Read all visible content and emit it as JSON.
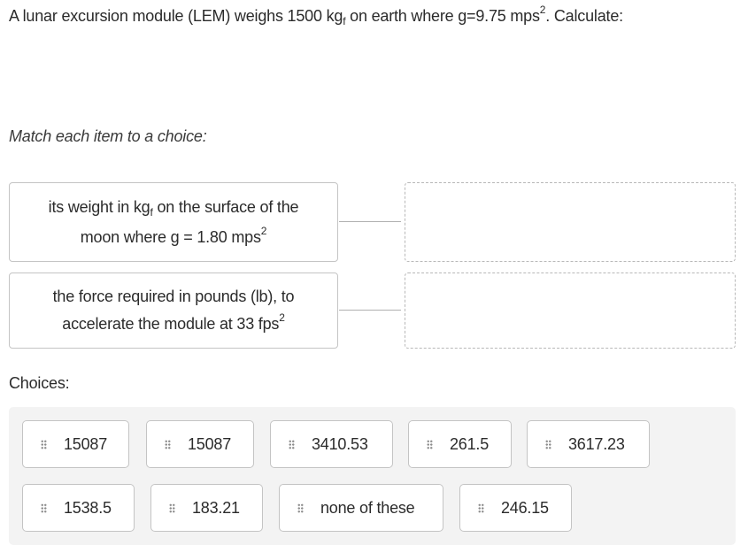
{
  "question": {
    "prefix": "A lunar excursion module (LEM) weighs 1500 kg",
    "sub": "f",
    "middle": " on earth where g=9.75 mps",
    "sup": "2",
    "suffix": ". Calculate:"
  },
  "instruction": "Match each item to a choice:",
  "items": [
    {
      "line1_prefix": "its weight in kg",
      "line1_sub": "f",
      "line1_suffix": " on the surface of the",
      "line2_prefix": "moon where g = 1.80 mps",
      "line2_sup": "2"
    },
    {
      "line1_prefix": "the force required in pounds (lb), to",
      "line2_prefix": "accelerate the module at 33 fps",
      "line2_sup": "2"
    }
  ],
  "dropzones": [
    "",
    ""
  ],
  "choices_label": "Choices:",
  "choices": [
    "15087",
    "15087",
    "3410.53",
    "261.5",
    "3617.23",
    "1538.5",
    "183.21",
    "none of these",
    "246.15"
  ],
  "colors": {
    "choices_background": "#f3f3f3",
    "border": "#c4c4c4",
    "dashed_border": "#b8b8b8",
    "text": "#2b2b2b"
  }
}
